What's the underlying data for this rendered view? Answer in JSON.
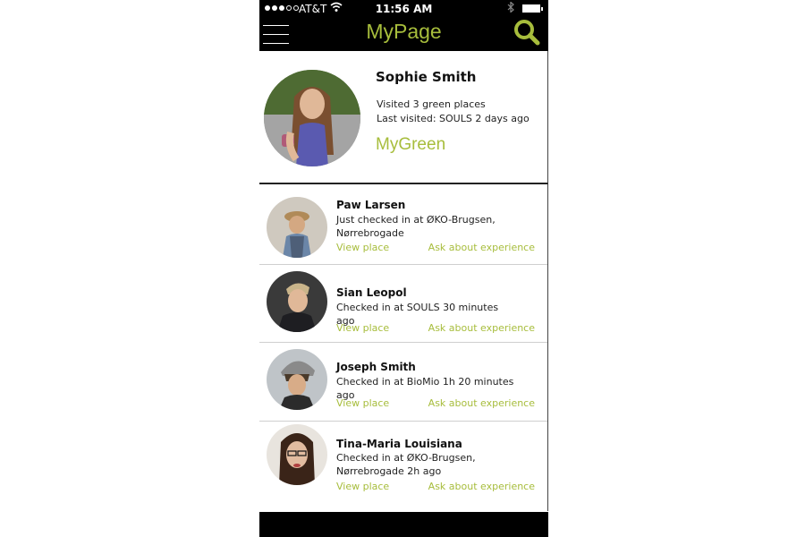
{
  "status_bar": {
    "carrier": "AT&T",
    "time": "11:56 AM"
  },
  "nav": {
    "title": "MyPage"
  },
  "profile": {
    "name": "Sophie Smith",
    "visited": "Visited 3 green places",
    "last_visited": "Last visited: SOULS 2 days ago",
    "link": "MyGreen"
  },
  "feed": [
    {
      "name": "Paw Larsen",
      "status": "Just checked in at ØKO-Brugsen, Nørrebrogade",
      "view_label": "View place",
      "ask_label": "Ask about experience"
    },
    {
      "name": "Sian Leopol",
      "status": "Checked in at SOULS 30 minutes ago",
      "view_label": "View place",
      "ask_label": "Ask about experience"
    },
    {
      "name": "Joseph Smith",
      "status": "Checked in at BioMio 1h 20 minutes ago",
      "view_label": "View place",
      "ask_label": "Ask about experience"
    },
    {
      "name": "Tina-Maria Louisiana",
      "status": "Checked in at ØKO-Brugsen, Nørrebrogade 2h ago",
      "view_label": "View place",
      "ask_label": "Ask about experience"
    }
  ],
  "colors": {
    "accent": "#a7bd3c",
    "bar": "#000000"
  },
  "icons": {
    "menu": "hamburger-menu-icon",
    "search": "search-icon",
    "wifi": "wifi-icon",
    "bluetooth": "bluetooth-icon",
    "battery": "battery-icon"
  }
}
